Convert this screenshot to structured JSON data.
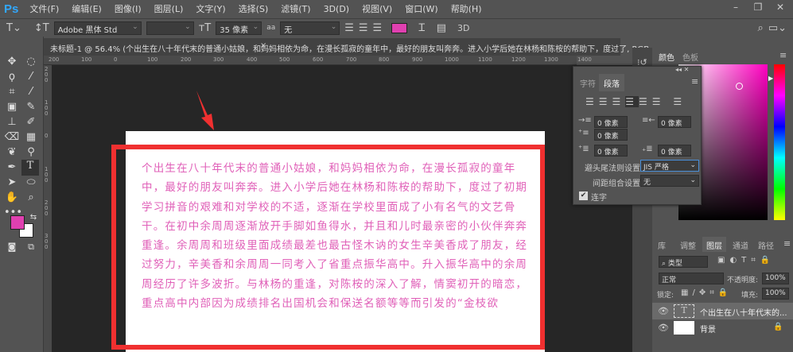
{
  "app": {
    "logo": "Ps"
  },
  "menu": [
    "文件(F)",
    "编辑(E)",
    "图像(I)",
    "图层(L)",
    "文字(Y)",
    "选择(S)",
    "滤镜(T)",
    "3D(D)",
    "视图(V)",
    "窗口(W)",
    "帮助(H)"
  ],
  "options": {
    "font_family": "Adobe 黑体 Std",
    "font_style": "",
    "font_size": "35 像素",
    "antialias_icon": "aa",
    "antialias": "无",
    "color": "#e040b0",
    "threed": "3D"
  },
  "document": {
    "tab_title": "未标题-1 @ 56.4% (个出生在八十年代末的普通小姑娘，和妈妈相依为命，在漫长孤寂的童年中，最好的朋友叫奔奔。进入小学后她在林杨和陈桉的帮助下，度过了, RGB...",
    "close": "×"
  },
  "ruler": {
    "top": [
      "200",
      "100",
      "0",
      "100",
      "200",
      "300",
      "400",
      "500",
      "600",
      "700",
      "800",
      "900",
      "1000",
      "1100",
      "1200",
      "1300",
      "1400"
    ],
    "left": [
      "200",
      "100",
      "0",
      "100",
      "200",
      "300"
    ]
  },
  "canvas": {
    "lines": [
      "个出生在八十年代末的普通小姑娘，和妈妈相依为命，在漫长孤寂的童年",
      "中，最好的朋友叫奔奔。进入小学后她在林杨和陈桉的帮助下，度过了初期",
      "学习拼音的艰难和对学校的不适，逐渐在学校里面成了小有名气的文艺骨",
      "干。在初中余周周逐渐放开手脚如鱼得水，并且和儿时最亲密的小伙伴奔奔",
      "重逢。余周周和班级里面成绩最差也最古怪木讷的女生辛美香成了朋友，经",
      "过努力，辛美香和余周周一同考入了省重点振华高中。升入振华高中的余周",
      "周经历了许多波折。与林杨的重逢，对陈桉的深入了解，情窦初开的暗恋，",
      "重点高中内部因为成绩排名出国机会和保送名额等等而引发的“金枝欲"
    ],
    "text_color": "#e060b8"
  },
  "paragraph_panel": {
    "tabs": [
      "字符",
      "段落"
    ],
    "indent_left": "0 像素",
    "indent_right": "0 像素",
    "indent_first": "0 像素",
    "space_before": "0 像素",
    "space_after": "0 像素",
    "kinsoku_label": "避头尾法则设置:",
    "kinsoku_value": "JIS 严格",
    "mojikumi_label": "间距组合设置:",
    "mojikumi_value": "无",
    "hyphenate": "连字"
  },
  "color_panel": {
    "tabs": [
      "颜色",
      "色板"
    ]
  },
  "layers_panel": {
    "tabs": [
      "库",
      "调整",
      "图层",
      "通道",
      "路径"
    ],
    "filter": "类型",
    "blend": "正常",
    "opacity_label": "不透明度:",
    "opacity": "100%",
    "lock_label": "锁定:",
    "fill_label": "填充:",
    "fill": "100%",
    "layers": [
      {
        "name": "个出生在八十年代末的..."
      },
      {
        "name": "背景"
      }
    ]
  }
}
